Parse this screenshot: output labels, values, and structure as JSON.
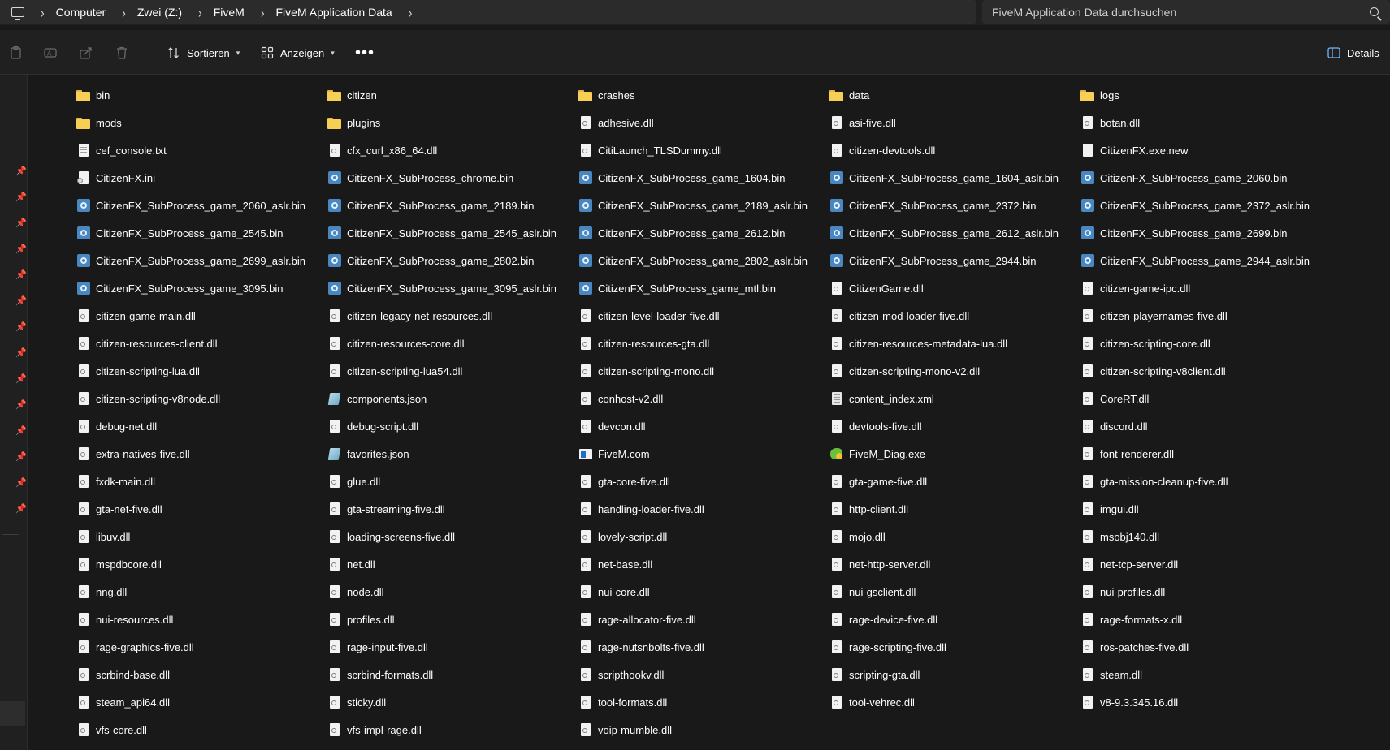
{
  "address": {
    "crumbs": [
      "Computer",
      "Zwei (Z:)",
      "FiveM",
      "FiveM Application Data"
    ],
    "search_placeholder": "FiveM Application Data durchsuchen"
  },
  "toolbar": {
    "sort_label": "Sortieren",
    "view_label": "Anzeigen",
    "more_label": "•••",
    "details_label": "Details"
  },
  "files": [
    {
      "name": "bin",
      "type": "folder"
    },
    {
      "name": "citizen",
      "type": "folder"
    },
    {
      "name": "crashes",
      "type": "folder"
    },
    {
      "name": "data",
      "type": "folder"
    },
    {
      "name": "logs",
      "type": "folder"
    },
    {
      "name": "mods",
      "type": "folder"
    },
    {
      "name": "plugins",
      "type": "folder"
    },
    {
      "name": "adhesive.dll",
      "type": "dll"
    },
    {
      "name": "asi-five.dll",
      "type": "dll"
    },
    {
      "name": "botan.dll",
      "type": "dll"
    },
    {
      "name": "cef_console.txt",
      "type": "txt"
    },
    {
      "name": "cfx_curl_x86_64.dll",
      "type": "dll"
    },
    {
      "name": "CitiLaunch_TLSDummy.dll",
      "type": "dll"
    },
    {
      "name": "citizen-devtools.dll",
      "type": "dll"
    },
    {
      "name": "CitizenFX.exe.new",
      "type": "file"
    },
    {
      "name": "CitizenFX.ini",
      "type": "ini"
    },
    {
      "name": "CitizenFX_SubProcess_chrome.bin",
      "type": "bin"
    },
    {
      "name": "CitizenFX_SubProcess_game_1604.bin",
      "type": "bin"
    },
    {
      "name": "CitizenFX_SubProcess_game_1604_aslr.bin",
      "type": "bin"
    },
    {
      "name": "CitizenFX_SubProcess_game_2060.bin",
      "type": "bin"
    },
    {
      "name": "CitizenFX_SubProcess_game_2060_aslr.bin",
      "type": "bin"
    },
    {
      "name": "CitizenFX_SubProcess_game_2189.bin",
      "type": "bin"
    },
    {
      "name": "CitizenFX_SubProcess_game_2189_aslr.bin",
      "type": "bin"
    },
    {
      "name": "CitizenFX_SubProcess_game_2372.bin",
      "type": "bin"
    },
    {
      "name": "CitizenFX_SubProcess_game_2372_aslr.bin",
      "type": "bin"
    },
    {
      "name": "CitizenFX_SubProcess_game_2545.bin",
      "type": "bin"
    },
    {
      "name": "CitizenFX_SubProcess_game_2545_aslr.bin",
      "type": "bin"
    },
    {
      "name": "CitizenFX_SubProcess_game_2612.bin",
      "type": "bin"
    },
    {
      "name": "CitizenFX_SubProcess_game_2612_aslr.bin",
      "type": "bin"
    },
    {
      "name": "CitizenFX_SubProcess_game_2699.bin",
      "type": "bin"
    },
    {
      "name": "CitizenFX_SubProcess_game_2699_aslr.bin",
      "type": "bin"
    },
    {
      "name": "CitizenFX_SubProcess_game_2802.bin",
      "type": "bin"
    },
    {
      "name": "CitizenFX_SubProcess_game_2802_aslr.bin",
      "type": "bin"
    },
    {
      "name": "CitizenFX_SubProcess_game_2944.bin",
      "type": "bin"
    },
    {
      "name": "CitizenFX_SubProcess_game_2944_aslr.bin",
      "type": "bin"
    },
    {
      "name": "CitizenFX_SubProcess_game_3095.bin",
      "type": "bin"
    },
    {
      "name": "CitizenFX_SubProcess_game_3095_aslr.bin",
      "type": "bin"
    },
    {
      "name": "CitizenFX_SubProcess_game_mtl.bin",
      "type": "bin"
    },
    {
      "name": "CitizenGame.dll",
      "type": "dll"
    },
    {
      "name": "citizen-game-ipc.dll",
      "type": "dll"
    },
    {
      "name": "citizen-game-main.dll",
      "type": "dll"
    },
    {
      "name": "citizen-legacy-net-resources.dll",
      "type": "dll"
    },
    {
      "name": "citizen-level-loader-five.dll",
      "type": "dll"
    },
    {
      "name": "citizen-mod-loader-five.dll",
      "type": "dll"
    },
    {
      "name": "citizen-playernames-five.dll",
      "type": "dll"
    },
    {
      "name": "citizen-resources-client.dll",
      "type": "dll"
    },
    {
      "name": "citizen-resources-core.dll",
      "type": "dll"
    },
    {
      "name": "citizen-resources-gta.dll",
      "type": "dll"
    },
    {
      "name": "citizen-resources-metadata-lua.dll",
      "type": "dll"
    },
    {
      "name": "citizen-scripting-core.dll",
      "type": "dll"
    },
    {
      "name": "citizen-scripting-lua.dll",
      "type": "dll"
    },
    {
      "name": "citizen-scripting-lua54.dll",
      "type": "dll"
    },
    {
      "name": "citizen-scripting-mono.dll",
      "type": "dll"
    },
    {
      "name": "citizen-scripting-mono-v2.dll",
      "type": "dll"
    },
    {
      "name": "citizen-scripting-v8client.dll",
      "type": "dll"
    },
    {
      "name": "citizen-scripting-v8node.dll",
      "type": "dll"
    },
    {
      "name": "components.json",
      "type": "json"
    },
    {
      "name": "conhost-v2.dll",
      "type": "dll"
    },
    {
      "name": "content_index.xml",
      "type": "xml"
    },
    {
      "name": "CoreRT.dll",
      "type": "dll"
    },
    {
      "name": "debug-net.dll",
      "type": "dll"
    },
    {
      "name": "debug-script.dll",
      "type": "dll"
    },
    {
      "name": "devcon.dll",
      "type": "dll"
    },
    {
      "name": "devtools-five.dll",
      "type": "dll"
    },
    {
      "name": "discord.dll",
      "type": "dll"
    },
    {
      "name": "extra-natives-five.dll",
      "type": "dll"
    },
    {
      "name": "favorites.json",
      "type": "json"
    },
    {
      "name": "FiveM.com",
      "type": "com"
    },
    {
      "name": "FiveM_Diag.exe",
      "type": "exe"
    },
    {
      "name": "font-renderer.dll",
      "type": "dll"
    },
    {
      "name": "fxdk-main.dll",
      "type": "dll"
    },
    {
      "name": "glue.dll",
      "type": "dll"
    },
    {
      "name": "gta-core-five.dll",
      "type": "dll"
    },
    {
      "name": "gta-game-five.dll",
      "type": "dll"
    },
    {
      "name": "gta-mission-cleanup-five.dll",
      "type": "dll"
    },
    {
      "name": "gta-net-five.dll",
      "type": "dll"
    },
    {
      "name": "gta-streaming-five.dll",
      "type": "dll"
    },
    {
      "name": "handling-loader-five.dll",
      "type": "dll"
    },
    {
      "name": "http-client.dll",
      "type": "dll"
    },
    {
      "name": "imgui.dll",
      "type": "dll"
    },
    {
      "name": "libuv.dll",
      "type": "dll"
    },
    {
      "name": "loading-screens-five.dll",
      "type": "dll"
    },
    {
      "name": "lovely-script.dll",
      "type": "dll"
    },
    {
      "name": "mojo.dll",
      "type": "dll"
    },
    {
      "name": "msobj140.dll",
      "type": "dll"
    },
    {
      "name": "mspdbcore.dll",
      "type": "dll"
    },
    {
      "name": "net.dll",
      "type": "dll"
    },
    {
      "name": "net-base.dll",
      "type": "dll"
    },
    {
      "name": "net-http-server.dll",
      "type": "dll"
    },
    {
      "name": "net-tcp-server.dll",
      "type": "dll"
    },
    {
      "name": "nng.dll",
      "type": "dll"
    },
    {
      "name": "node.dll",
      "type": "dll"
    },
    {
      "name": "nui-core.dll",
      "type": "dll"
    },
    {
      "name": "nui-gsclient.dll",
      "type": "dll"
    },
    {
      "name": "nui-profiles.dll",
      "type": "dll"
    },
    {
      "name": "nui-resources.dll",
      "type": "dll"
    },
    {
      "name": "profiles.dll",
      "type": "dll"
    },
    {
      "name": "rage-allocator-five.dll",
      "type": "dll"
    },
    {
      "name": "rage-device-five.dll",
      "type": "dll"
    },
    {
      "name": "rage-formats-x.dll",
      "type": "dll"
    },
    {
      "name": "rage-graphics-five.dll",
      "type": "dll"
    },
    {
      "name": "rage-input-five.dll",
      "type": "dll"
    },
    {
      "name": "rage-nutsnbolts-five.dll",
      "type": "dll"
    },
    {
      "name": "rage-scripting-five.dll",
      "type": "dll"
    },
    {
      "name": "ros-patches-five.dll",
      "type": "dll"
    },
    {
      "name": "scrbind-base.dll",
      "type": "dll"
    },
    {
      "name": "scrbind-formats.dll",
      "type": "dll"
    },
    {
      "name": "scripthookv.dll",
      "type": "dll"
    },
    {
      "name": "scripting-gta.dll",
      "type": "dll"
    },
    {
      "name": "steam.dll",
      "type": "dll"
    },
    {
      "name": "steam_api64.dll",
      "type": "dll"
    },
    {
      "name": "sticky.dll",
      "type": "dll"
    },
    {
      "name": "tool-formats.dll",
      "type": "dll"
    },
    {
      "name": "tool-vehrec.dll",
      "type": "dll"
    },
    {
      "name": "v8-9.3.345.16.dll",
      "type": "dll"
    },
    {
      "name": "vfs-core.dll",
      "type": "dll"
    },
    {
      "name": "vfs-impl-rage.dll",
      "type": "dll"
    },
    {
      "name": "voip-mumble.dll",
      "type": "dll"
    }
  ]
}
